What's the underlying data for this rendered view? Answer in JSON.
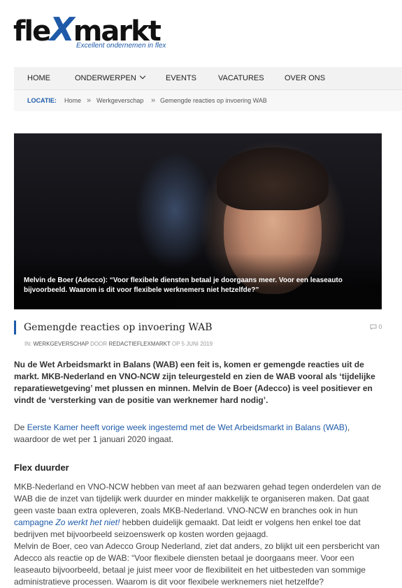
{
  "brand": {
    "logo_prefix": "fle",
    "logo_x": "X",
    "logo_suffix": "markt",
    "tagline": "Excellent ondernemen in flex"
  },
  "nav": {
    "items": [
      "HOME",
      "ONDERWERPEN",
      "EVENTS",
      "VACATURES",
      "OVER ONS"
    ]
  },
  "breadcrumb": {
    "label": "LOCATIE:",
    "items": [
      "Home",
      "Werkgeverschap",
      "Gemengde reacties op invoering WAB"
    ],
    "separator": "»"
  },
  "hero": {
    "caption": "Melvin de Boer (Adecco): “Voor flexibele diensten betaal je doorgaans meer. Voor een leaseauto bijvoorbeeld. Waarom is dit voor flexibele werknemers niet hetzelfde?”"
  },
  "article": {
    "title": "Gemengde reacties op invoering WAB",
    "comment_count": "0",
    "meta": {
      "in_label": "IN:",
      "category": "WERKGEVERSCHAP",
      "by_label": "DOOR",
      "author": "REDACTIEFLEXMARKT",
      "on_label": "OP",
      "date": "5 JUNI 2019"
    },
    "lead": "Nu de Wet Arbeidsmarkt in Balans (WAB) een feit is, komen er gemengde reacties uit de markt. MKB-Nederland en VNO-NCW zijn teleurgesteld en zien de WAB vooral als ‘tijdelijke reparatiewetgeving’ met plussen en minnen. Melvin de Boer (Adecco) is veel positiever en vindt de ‘versterking van de positie van werknemer hard nodig’.",
    "p1_start": "De ",
    "p1_link": "Eerste Kamer heeft vorige week ingestemd met de Wet Arbeidsmarkt in Balans (WAB)",
    "p1_end": ", waardoor de wet per 1 januari 2020 ingaat.",
    "h2": "Flex duurder",
    "p2_a": "MKB-Nederland en VNO-NCW hebben van meet af aan bezwaren gehad tegen onderdelen van de WAB die de inzet van tijdelijk werk duurder en minder makkelijk te organiseren maken. Dat gaat geen vaste baan extra opleveren, zoals MKB-Nederland. VNO-NCW en branches ook in hun ",
    "p2_link": "campagne ",
    "p2_link_italic": "Zo werkt het niet!",
    "p2_b": " hebben duidelijk gemaakt. Dat leidt er volgens hen enkel toe dat bedrijven met bijvoorbeeld seizoenswerk op kosten worden gejaagd.",
    "p2_c": "Melvin de Boer, ceo van Adecco Group Nederland, ziet dat anders, zo blijkt uit een persbericht van Adecco als reactie op de WAB: “Voor flexibele diensten betaal je doorgaans meer. Voor een leaseauto bijvoorbeeld, betaal je juist meer voor de flexibiliteit en het uitbesteden van sommige administratieve processen. Waarom is dit voor flexibele werknemers niet hetzelfde?"
  }
}
